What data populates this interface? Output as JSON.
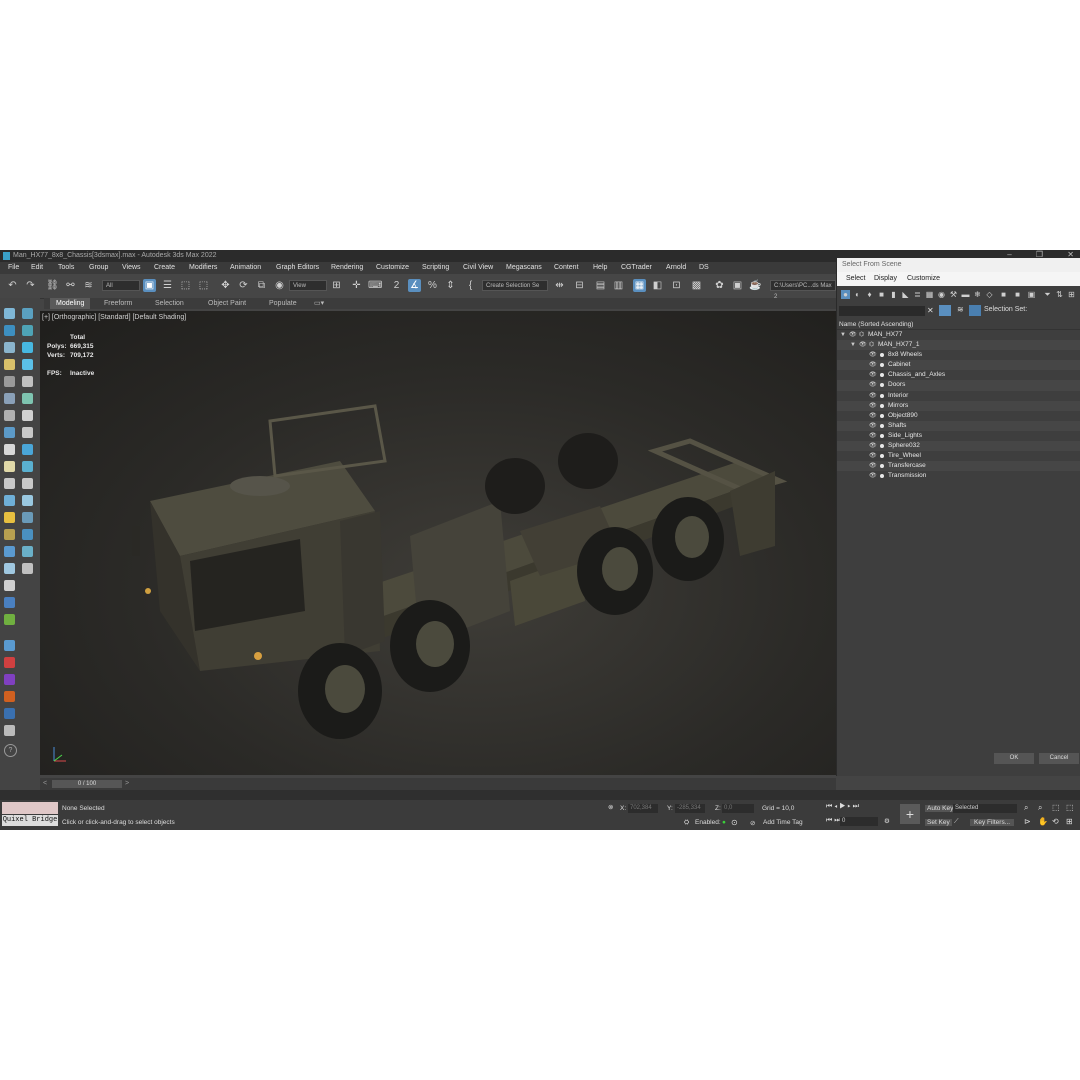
{
  "window": {
    "title": "Man_HX77_8x8_Chassis[3dsmax].max - Autodesk 3ds Max 2022"
  },
  "menu": [
    "File",
    "Edit",
    "Tools",
    "Group",
    "Views",
    "Create",
    "Modifiers",
    "Animation",
    "Graph Editors",
    "Rendering",
    "Customize",
    "Scripting",
    "Civil View",
    "Megascans",
    "Content",
    "Help",
    "CGTrader",
    "Arnold",
    "DS"
  ],
  "toolbar": {
    "filter_value": "All",
    "view_value": "View",
    "selection_set_placeholder": "Create Selection Se",
    "path_value": "C:\\Users\\PC...ds Max 2"
  },
  "ribbon": {
    "tabs": [
      "Modeling",
      "Freeform",
      "Selection",
      "Object Paint",
      "Populate"
    ]
  },
  "viewport": {
    "label": "[+] [Orthographic] [Standard] [Default Shading]",
    "stats": {
      "header": "Total",
      "polys_label": "Polys:",
      "polys": "669,315",
      "verts_label": "Verts:",
      "verts": "709,172",
      "fps_label": "FPS:",
      "fps": "Inactive"
    }
  },
  "timeline": {
    "frame": "0 / 100"
  },
  "status": {
    "script_label": "Quixel Bridge",
    "selection": "None Selected",
    "prompt": "Click or click-and-drag to select objects",
    "x_label": "X:",
    "x": "702,384",
    "y_label": "Y:",
    "y": "-285,334",
    "z_label": "Z:",
    "z": "0,0",
    "grid": "Grid = 10,0",
    "enabled_label": "Enabled:",
    "add_time_tag": "Add Time Tag",
    "auto_key": "Auto Key",
    "set_key": "Set Key",
    "key_mode": "Selected",
    "key_filters": "Key Filters...",
    "frame_field": "0"
  },
  "scene_explorer": {
    "title": "Select From Scene",
    "menu": [
      "Select",
      "Display",
      "Customize"
    ],
    "selection_set_label": "Selection Set:",
    "column_header": "Name (Sorted Ascending)",
    "root": "MAN_HX77",
    "group": "MAN_HX77_1",
    "items": [
      "8x8 Wheels",
      "Cabinet",
      "Chassis_and_Axles",
      "Doors",
      "Interior",
      "Mirrors",
      "Object890",
      "Shafts",
      "Side_Lights",
      "Sphere032",
      "Tire_Wheel",
      "Transfercase",
      "Transmission"
    ],
    "ok": "OK",
    "cancel": "Cancel"
  },
  "colors": {
    "active_tool": "#5a8fbf",
    "viewport_bg": "#2b2a27",
    "ui_bg": "#444444"
  }
}
